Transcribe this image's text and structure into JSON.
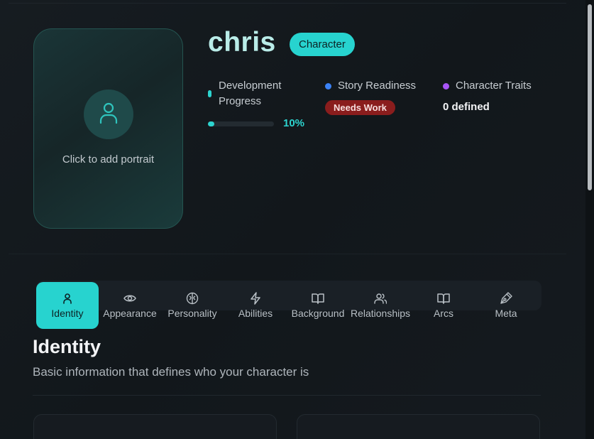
{
  "character": {
    "name": "chris",
    "badge": "Character",
    "portrait_label": "Click to add portrait"
  },
  "stats": {
    "development": {
      "label": "Development Progress",
      "value": "10%",
      "fraction": 0.1,
      "color": "#2dd4cf"
    },
    "story": {
      "label": "Story Readiness",
      "status": "Needs Work",
      "color": "#3b82f6"
    },
    "traits": {
      "label": "Character Traits",
      "value": "0 defined",
      "color": "#a855f7"
    }
  },
  "tabs": [
    {
      "label": "Identity",
      "icon": "user-icon",
      "active": true
    },
    {
      "label": "Appearance",
      "icon": "eye-icon",
      "active": false
    },
    {
      "label": "Personality",
      "icon": "brain-icon",
      "active": false
    },
    {
      "label": "Abilities",
      "icon": "lightning-icon",
      "active": false
    },
    {
      "label": "Background",
      "icon": "book-icon",
      "active": false
    },
    {
      "label": "Relationships",
      "icon": "users-icon",
      "active": false
    },
    {
      "label": "Arcs",
      "icon": "book-open-icon",
      "active": false
    },
    {
      "label": "Meta",
      "icon": "pen-tool-icon",
      "active": false
    }
  ],
  "section": {
    "title": "Identity",
    "subtitle": "Basic information that defines who your character is"
  },
  "colors": {
    "accent": "#27d3cf",
    "danger": "#8a1d1d",
    "background": "#13181d"
  }
}
